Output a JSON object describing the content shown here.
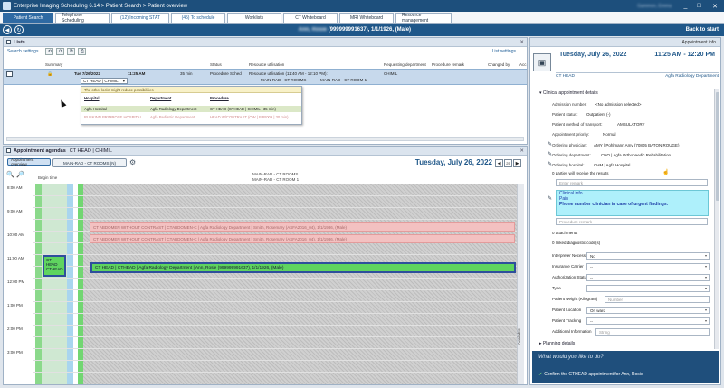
{
  "window": {
    "title": "Enterprise Imaging Scheduling 6.14 > Patient Search > Patient overview",
    "user": "Gammon, Emma",
    "controls": [
      "_",
      "□",
      "✕"
    ]
  },
  "tabs": [
    {
      "label": "Patient Search",
      "active": true
    },
    {
      "label": "Telephone Scheduling"
    },
    {
      "label": "(12) Incoming STAT"
    },
    {
      "label": "(45) To schedule"
    },
    {
      "label": "Worklists"
    },
    {
      "label": "CT Whiteboard"
    },
    {
      "label": "MRI Whiteboard"
    },
    {
      "label": "Resource management"
    }
  ],
  "patient_bar": {
    "name": "Ann, Rosie",
    "info": "(999999991637), 1/1/1926, (Male)",
    "back_label": "Back to start"
  },
  "lists": {
    "title": "Lists",
    "search_settings": "Search settings",
    "list_settings": "List settings",
    "columns": [
      "Summary",
      "Status",
      "Resource utilisation",
      "Requesting department",
      "Procedure remark",
      "Changed by",
      "Acc"
    ],
    "row": {
      "date": "Tue 7/26/2022",
      "time": "11:25 AM",
      "duration": "35 min",
      "status": "Procedure Sched",
      "utilisation": "Resource utilisation (11:40 AM - 12:10 PM):",
      "rooms1": "MAIN-RAD - CT ROOMS",
      "rooms2": "MAIN-RAD - CT ROOM 1",
      "requesting": "CHIMIL",
      "procedure_dropdown": "CT HEAD | CHIMIL"
    },
    "popup": {
      "warning": "The other locks might reduce possibilities",
      "headers": [
        "Hospital",
        "Department",
        "Procedure"
      ],
      "row1": [
        "Agfa Hospital",
        "Agfa Radiology Department",
        "CT HEAD (CTHEAD | CHIMIL | 35 min)"
      ],
      "row2": [
        "RUSKINN PRIMROSE HOSPITAL",
        "Agfa Pediatric Department",
        "HEAD W/CONTRAST (OW | B3R009 | 30 min)"
      ]
    }
  },
  "agenda": {
    "title": "Appointment agendas",
    "subtitle": "CT HEAD | CHIMIL",
    "btn_overview": "Appointment overview",
    "btn_rooms": "MAIN-RAD - CT ROOMS (N)",
    "date": "Tuesday, July 26, 2022",
    "day_num": "25",
    "res_caption1": "MAIN-RAD - CT ROOMS",
    "res_caption2": "MAIN-RAD - CT ROOM 1",
    "col_label": "Begin time",
    "times": [
      "8:00 AM",
      "9:00 AM",
      "10:00 AM",
      "11:00 AM",
      "12:00 PM",
      "1:00 PM",
      "2:00 PM",
      "3:00 PM"
    ],
    "pink1": "CT ABDOMEN WITHOUT CONTRAST | CTABDOMEN-C | Agfa Radiology Department | Smith, Rosemary (ASFA2016_04), 1/1/1986, (Male)",
    "pink2": "CT ABDOMEN WITHOUT CONTRAST | CTABDOMEN-C | Agfa Radiology Department | Smith, Rosemary (ASFA2016_04), 1/1/1986, (Male)",
    "green": "CT HEAD | CTHEAD | Agfa Radiology Department | Ann, Rosie (999999991637), 1/1/1926, (Male)",
    "mini": [
      "CT HEAD",
      "CTHEAD"
    ],
    "vertical_label": "Available"
  },
  "right": {
    "header": "Appointment info",
    "date": "Tuesday, July 26, 2022",
    "time": "11:25 AM - 12:20 PM",
    "procedure": "CT HEAD",
    "department": "Agfa Radiology Department",
    "section1": "Clinical appointment details",
    "fields": [
      {
        "label": "Admission number:",
        "value": "<No admission selected>"
      },
      {
        "label": "Patient status:",
        "value": "Outpatient (-)"
      },
      {
        "label": "Patient method of transport:",
        "value": "AMBULATORY"
      },
      {
        "label": "Appointment priority:",
        "value": "Normal"
      },
      {
        "label": "Ordering physician:",
        "value": "AMY | Pohlmann Amy (70805 BATON ROUGE)"
      },
      {
        "label": "Ordering department:",
        "value": "CHO | Agfa Orthopaedic Rehabilitation"
      },
      {
        "label": "Ordering hospital:",
        "value": "CHM | Agfa Hospital"
      }
    ],
    "parties": "0 parties will receive the results",
    "enter_remark": "Enter remark",
    "clinical_info": "Clinical info",
    "pain": "Pain",
    "phone_label": "Phone number clinician in case of urgent findings:",
    "procedure_remark": "Procedure remark",
    "attachments": "0 attachments",
    "diag_codes": "0 linked diagnostic code(s)",
    "extra": [
      {
        "label": "Interpreter Necessary",
        "value": "No"
      },
      {
        "label": "Insurance Carrier",
        "value": "--"
      },
      {
        "label": "Authorization Status",
        "value": "--"
      },
      {
        "label": "Type",
        "value": "--"
      },
      {
        "label": "Patient weight (Kilogram)",
        "value": "Number"
      },
      {
        "label": "Patient Location",
        "value": "On ward"
      },
      {
        "label": "Patient Tracking",
        "value": "--"
      },
      {
        "label": "Additional Information",
        "value": "String"
      }
    ],
    "section2": "Planning details",
    "prompt": "What would you like to do?",
    "action": "Confirm the CTHEAD appointment for Ann, Rosie"
  }
}
